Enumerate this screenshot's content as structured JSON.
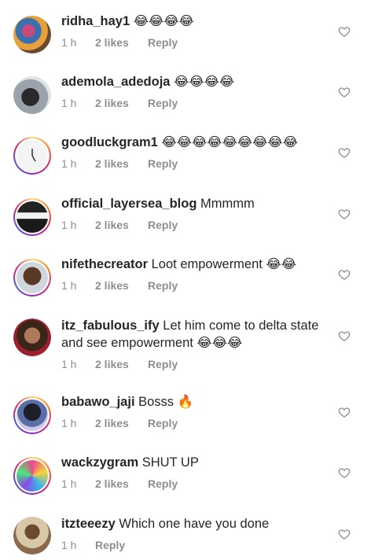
{
  "comments": [
    {
      "username": "ridha_hay1",
      "text": "😂😂😂😂",
      "time": "1 h",
      "likes": "2 likes",
      "reply": "Reply"
    },
    {
      "username": "ademola_adedoja",
      "text": "😂😂😂😂",
      "time": "1 h",
      "likes": "2 likes",
      "reply": "Reply"
    },
    {
      "username": "goodluckgram1",
      "text": "😂😂😂😂😂😂😂😂😂",
      "time": "1 h",
      "likes": "2 likes",
      "reply": "Reply"
    },
    {
      "username": "official_layersea_blog",
      "text": "Mmmmm",
      "time": "1 h",
      "likes": "2 likes",
      "reply": "Reply"
    },
    {
      "username": "nifethecreator",
      "text": "Loot empowerment 😂😂",
      "time": "1 h",
      "likes": "2 likes",
      "reply": "Reply"
    },
    {
      "username": "itz_fabulous_ify",
      "text": "Let him come to delta state and see empowerment 😂😂😂",
      "time": "1 h",
      "likes": "2 likes",
      "reply": "Reply"
    },
    {
      "username": "babawo_jaji",
      "text": "Bosss 🔥",
      "time": "1 h",
      "likes": "2 likes",
      "reply": "Reply"
    },
    {
      "username": "wackzygram",
      "text": "SHUT UP",
      "time": "1 h",
      "likes": "2 likes",
      "reply": "Reply"
    },
    {
      "username": "itzteeezy",
      "text": "Which one have you done",
      "time": "1 h",
      "likes": "",
      "reply": "Reply"
    }
  ],
  "icons": {
    "heart": "heart-outline-icon"
  },
  "colors": {
    "text": "#262626",
    "meta": "#8e8e8e",
    "heart": "#8e8e8e"
  }
}
